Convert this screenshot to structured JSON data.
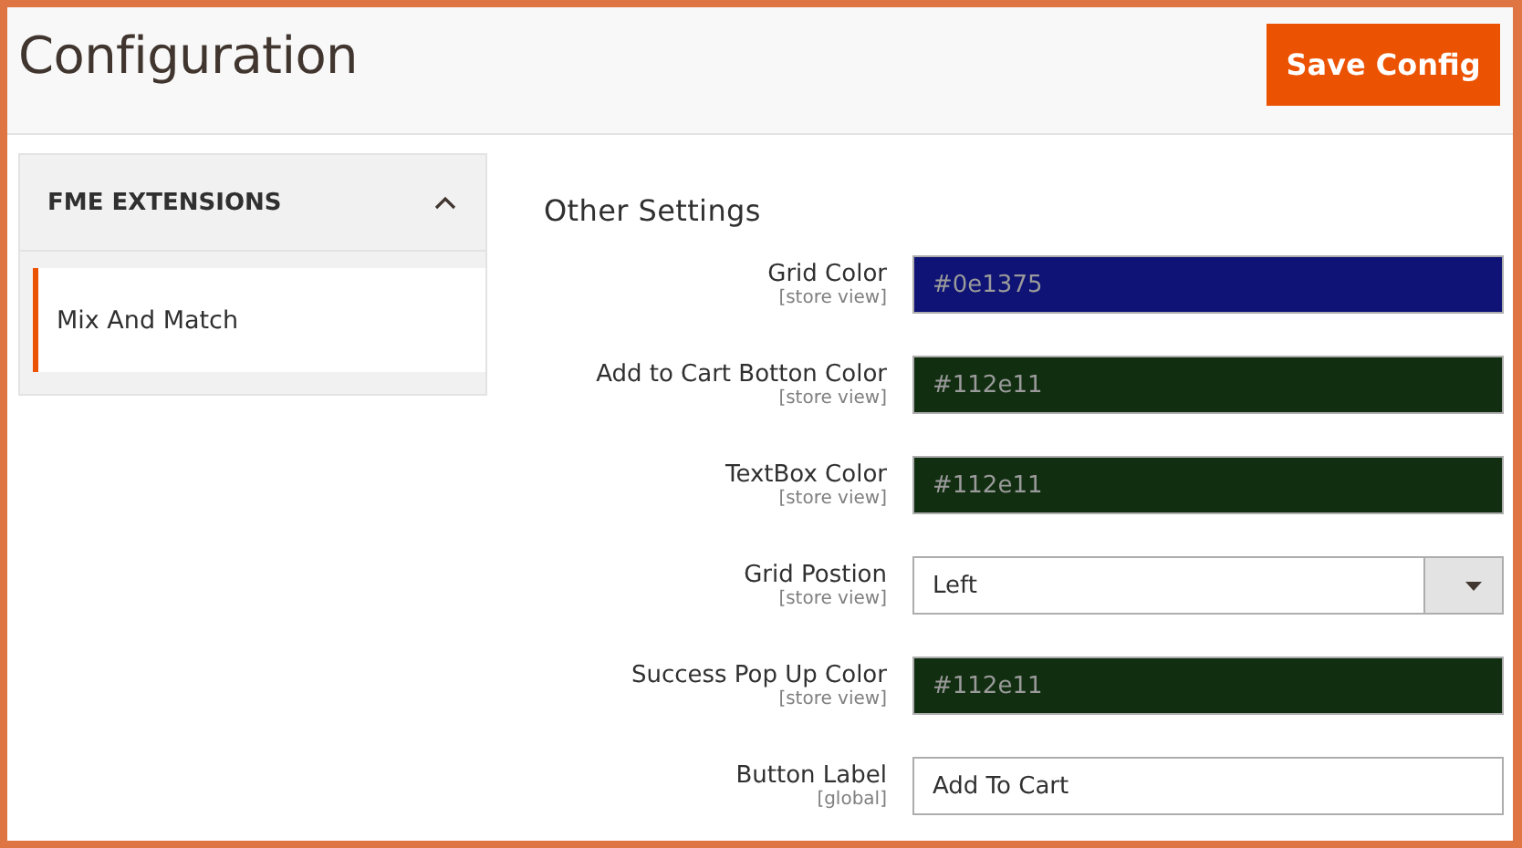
{
  "page": {
    "title": "Configuration",
    "save_button": "Save Config"
  },
  "sidebar": {
    "section": {
      "label": "FME EXTENSIONS",
      "expanded": true
    },
    "items": [
      {
        "label": "Mix And Match",
        "selected": true
      }
    ]
  },
  "form": {
    "heading": "Other Settings",
    "fields": [
      {
        "kind": "color",
        "label": "Grid Color",
        "scope": "[store view]",
        "value": "#0e1375",
        "color": "#0e1375"
      },
      {
        "kind": "color",
        "label": "Add to Cart Botton Color",
        "scope": "[store view]",
        "value": "#112e11",
        "color": "#112e11"
      },
      {
        "kind": "color",
        "label": "TextBox Color",
        "scope": "[store view]",
        "value": "#112e11",
        "color": "#112e11"
      },
      {
        "kind": "select",
        "label": "Grid Postion",
        "scope": "[store view]",
        "value": "Left"
      },
      {
        "kind": "color",
        "label": "Success Pop Up Color",
        "scope": "[store view]",
        "value": "#112e11",
        "color": "#112e11"
      },
      {
        "kind": "text",
        "label": "Button Label",
        "scope": "[global]",
        "value": "Add To Cart"
      }
    ]
  }
}
